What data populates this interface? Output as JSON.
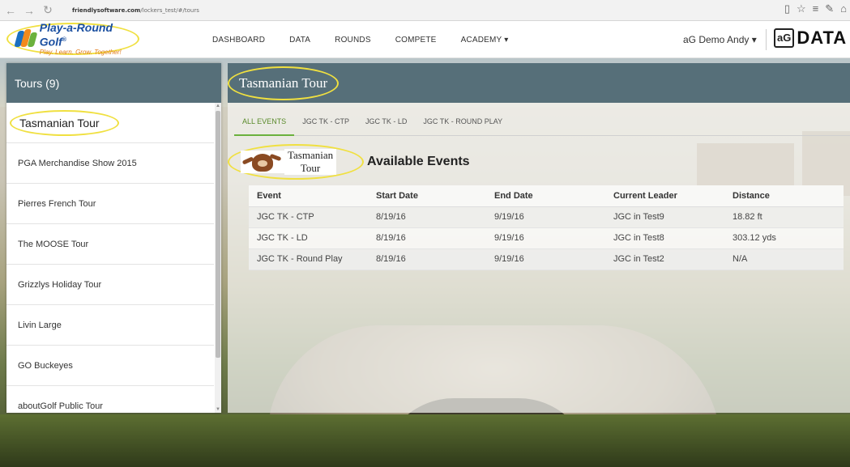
{
  "browser": {
    "back": "←",
    "forward": "→",
    "refresh": "↻",
    "address_domain": "friendlysoftware.com",
    "address_path": "/lockers_test/#/tours",
    "icons": [
      "reading-view-icon",
      "favorite-star-icon",
      "hub-icon",
      "notes-icon",
      "share-icon"
    ]
  },
  "header": {
    "brand": "Play-a-Round Golf",
    "brand_mark": "®",
    "tagline": "Play. Learn. Grow. Together!",
    "nav": [
      "DASHBOARD",
      "DATA",
      "ROUNDS",
      "COMPETE",
      "ACADEMY ▾"
    ],
    "user": "aG Demo Andy ▾",
    "ag_box": "aG",
    "ag_data": "DATA"
  },
  "sidebar": {
    "title": "Tours (9)",
    "items": [
      {
        "label": "Tasmanian Tour",
        "active": true
      },
      {
        "label": "PGA Merchandise Show 2015"
      },
      {
        "label": "Pierres French Tour"
      },
      {
        "label": "The MOOSE Tour"
      },
      {
        "label": "Grizzlys Holiday Tour"
      },
      {
        "label": "Livin Large"
      },
      {
        "label": "GO Buckeyes"
      },
      {
        "label": "aboutGolf Public Tour"
      }
    ]
  },
  "main": {
    "title": "Tasmanian Tour",
    "tabs": [
      "ALL EVENTS",
      "JGC TK - CTP",
      "JGC TK - LD",
      "JGC TK - ROUND PLAY"
    ],
    "logo_text_1": "Tasmanian",
    "logo_text_2": "Tour",
    "events_title": "Available Events",
    "table": {
      "headers": [
        "Event",
        "Start Date",
        "End Date",
        "Current Leader",
        "Distance"
      ],
      "rows": [
        [
          "JGC TK - CTP",
          "8/19/16",
          "9/19/16",
          "JGC in Test9",
          "18.82 ft"
        ],
        [
          "JGC TK - LD",
          "8/19/16",
          "9/19/16",
          "JGC in Test8",
          "303.12 yds"
        ],
        [
          "JGC TK - Round Play",
          "8/19/16",
          "9/19/16",
          "JGC in Test2",
          "N/A"
        ]
      ]
    }
  },
  "colors": {
    "panel_header": "#566f79",
    "highlight": "#f0e040",
    "tab_active": "#6bb13d"
  }
}
